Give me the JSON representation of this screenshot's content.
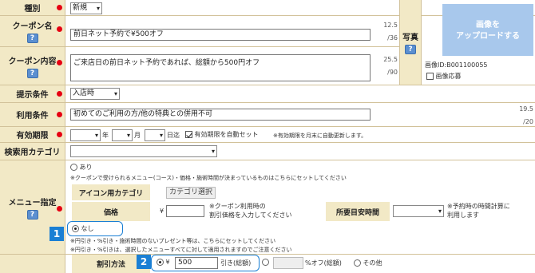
{
  "type_row": {
    "label": "種別",
    "value": "新規"
  },
  "coupon_name": {
    "label": "クーポン名",
    "value": "前日ネット予約で¥500オフ",
    "count": "12.5",
    "max": "/36"
  },
  "photo": {
    "label": "写真",
    "upload_button": "画像を\nアップロードする",
    "image_id": "画像ID:B001100055",
    "apply_label": "画像応募"
  },
  "coupon_content": {
    "label": "クーポン内容",
    "value": "ご来店日の前日ネット予約であれば、総額から500円オフ",
    "count": "25.5",
    "max": "/90"
  },
  "present_condition": {
    "label": "提示条件",
    "value": "入店時"
  },
  "usage_condition": {
    "label": "利用条件",
    "value": "初めてのご利用の方/他の特典との併用不可",
    "count": "19.5",
    "max": "/20"
  },
  "expiry": {
    "label": "有効期限",
    "year_unit": "年",
    "month_unit": "月",
    "day_unit": "日迄",
    "auto_renew_label": "有効期限を自動セット",
    "note": "※有効期限を月末に自動更新します。"
  },
  "search_category": {
    "label": "検索用カテゴリ",
    "value": ""
  },
  "menu": {
    "label": "メニュー指定",
    "option_yes": "あり",
    "yes_note": "※クーポンで受けられるメニュー(コース)・価格・施術時間が決まっているものはこちらにセットしてください",
    "icon_category_label": "アイコン用カテゴリ",
    "category_select_button": "カテゴリ選択",
    "price_label": "価格",
    "yen": "¥",
    "price_note": "※クーポン利用時の\n割引価格を入力してください",
    "time_label": "所要目安時間",
    "time_note": "※予約時の時間計算に\n利用します",
    "option_no": "なし",
    "no_note1": "※円引き・%引き・施術時間のないプレゼント等は、こちらにセットしてください",
    "no_note2": "※円引き・%引きは、選択したメニューすべてに対して適用されますのでご注意ください"
  },
  "discount": {
    "label": "割引方法",
    "yen": "¥",
    "amount": "500",
    "amount_unit": "引き(総額)",
    "percent_unit": "%オフ(総額)",
    "other_label": "その他"
  },
  "badges": {
    "one": "1",
    "two": "2"
  },
  "colors": {
    "label_bg": "#f2e9c6",
    "required_dot": "#e60012",
    "accent_blue": "#1a7fd4",
    "upload_bg": "#a8c8ec"
  },
  "help_icon": "?"
}
